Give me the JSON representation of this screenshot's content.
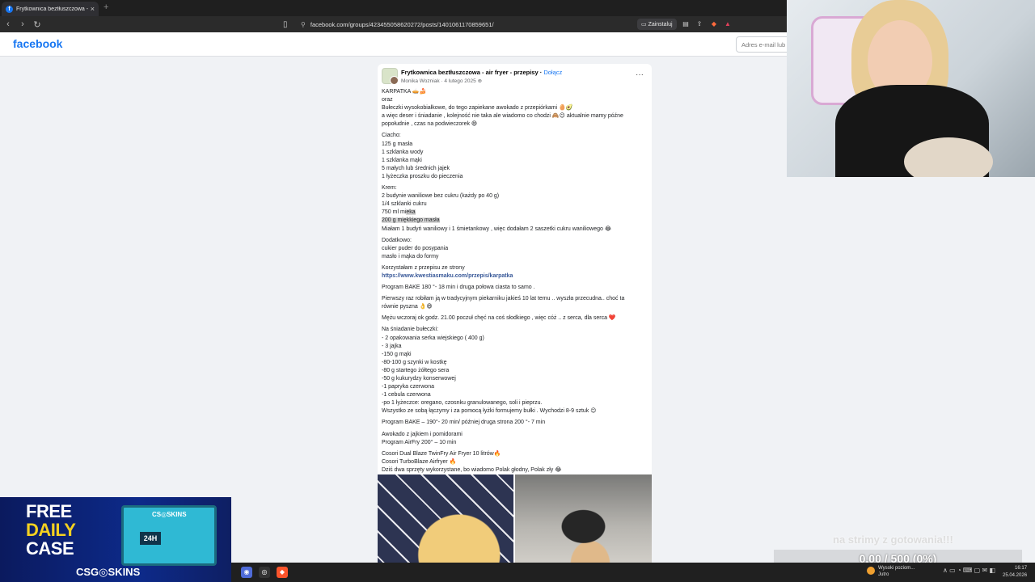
{
  "browser": {
    "tab_title": "Frytkownica beztłuszczowa - air",
    "close_glyph": "×",
    "new_tab_glyph": "+",
    "url": "facebook.com/groups/423455058620272/posts/1401061170859651/",
    "install_label": "Zainstaluj"
  },
  "facebook": {
    "logo": "facebook",
    "email_placeholder": "Adres e-mail lub",
    "post": {
      "group_name": "Frytkownica beztłuszczowa - air fryer - przepisy",
      "join_label": "Dołącz",
      "author": "Monika Wozniak",
      "date": "4 lutego 2025",
      "more_glyph": "···",
      "lines": [
        "KARPATKA 🥧🍰",
        "     oraz",
        "Bułeczki wysokobiałkowe, do tego zapiekane awokado     z przepiórkami 🥚🥑",
        "a więc deser i śniadanie , kolejność nie taka ale wiadomo co chodzi 🙈😉 aktualnie mamy późne",
        "popołudnie , czas na podwieczorek 😄",
        "",
        "Ciacho:",
        "125 g masła",
        "1 szklanka wody",
        "1 szklanka mąki",
        "5 małych lub średnich jajek",
        "1 łyżeczka proszku do pieczenia",
        "",
        "Krem:",
        "2 budynie waniliowe bez cukru (każdy po 40 g)",
        "1/4 szklanki cukru"
      ],
      "hl_line_a_pre": "750 ml mi",
      "hl_line_a_hl": "eka",
      "hl_line_b": "200 g miękkiego masła",
      "lines2": [
        "Miałam 1 budyń waniliowy i 1 śmietankowy , więc dodałam 2 saszetki cukru waniliowego 😂",
        "",
        "Dodatkowo:",
        "cukier puder do posypania",
        "masło i mąka do formy",
        "",
        "Korzystałam z przepisu ze strony"
      ],
      "link": "https://www.kwestiasmaku.com/przepis/karpatka",
      "lines3": [
        "",
        "Program BAKE 180 °- 18 min i druga połowa ciasta to samo .",
        "",
        "Pierwszy raz robiłam ją w tradycyjnym piekarniku jakieś 10 lat temu ..  wyszła przecudna..  choć ta",
        "równie pyszna 👌😄",
        "",
        "Mężu wczoraj ok godz. 21.00 poczuł chęć na coś słodkiego , więc cóż .. z serca, dla serca ❤️",
        "",
        "Na śniadanie bułeczki:",
        "- 2 opakowania serka wiejskiego ( 400 g)",
        "- 3 jajka",
        "-150 g mąki",
        "-80-100 g szynki w kostkę",
        "-80 g startego żółtego sera",
        "-50 g kukurydzy konserwowej",
        "-1 papryka czerwona",
        "-1 cebula czerwona",
        "-po 1 łyżeczce: oregano, czosnku granulowanego, soli i pieprzu.",
        "Wszystko ze sobą łączymy i za pomocą łyżki formujemy bułki . Wychodzi 8-9 sztuk 😉",
        "",
        "Program BAKE – 190°- 20 min/ później druga strona 200 °- 7 min",
        "",
        "Awokado z jajkiem i pomidorami",
        "Program AirFry 200° – 10 min",
        "",
        " Cosori Dual Blaze TwinFry Air Fryer 10 litrów🔥",
        " Cosori TurboBlaze Airfryer 🔥",
        " Dziś dwa sprzęty wykorzystane, bo wiadomo Polak głodny, Polak zły 😂"
      ]
    }
  },
  "ad": {
    "line1": "FREE",
    "line2": "DAILY",
    "line3": "CASE",
    "chest_label": "CS◎SKINS",
    "chest_number": "24H",
    "brand": "CSG◎SKINS"
  },
  "donation": {
    "title": "na strimy z gotowania!!!",
    "progress_text": "0.00 / 500 (0%)",
    "progress_fraction": 0.0
  },
  "taskbar": {
    "weather_title": "Wysoki poziom...",
    "weather_sub": "Jutro",
    "tray_icons": "∧  ▭  ◔  ⌨  ▢  ✉  ◧",
    "time": "16:17",
    "date": "25.04.2026"
  },
  "colors": {
    "facebook_blue": "#1877f2",
    "donation_fill": "#4e8df0",
    "ad_yellow": "#f5d120"
  }
}
